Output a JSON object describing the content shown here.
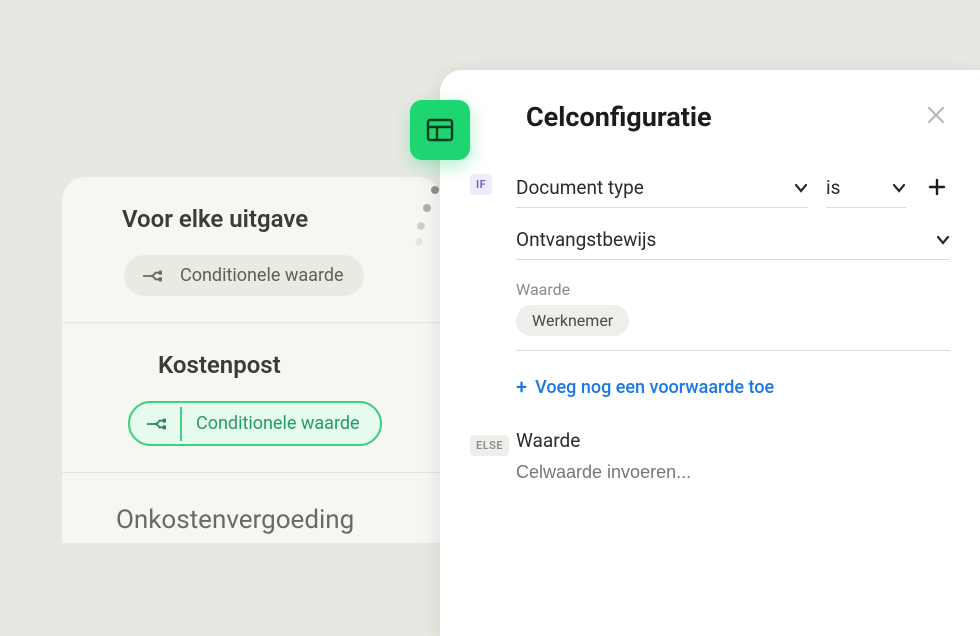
{
  "left": {
    "section1": {
      "title": "Voor elke uitgave",
      "pill": "Conditionele waarde"
    },
    "section2": {
      "title": "Kostenpost",
      "pill": "Conditionele waarde"
    },
    "section3": {
      "title": "Onkostenvergoeding"
    }
  },
  "panel": {
    "title": "Celconfiguratie",
    "if_label": "IF",
    "else_label": "ELSE",
    "field_doc_type": "Document type",
    "operator": "is",
    "value_select": "Ontvangstbewijs",
    "value_label": "Waarde",
    "chip_value": "Werknemer",
    "add_condition": "Voeg nog een voorwaarde toe",
    "else_value_label": "Waarde",
    "else_placeholder": "Celwaarde invoeren..."
  }
}
